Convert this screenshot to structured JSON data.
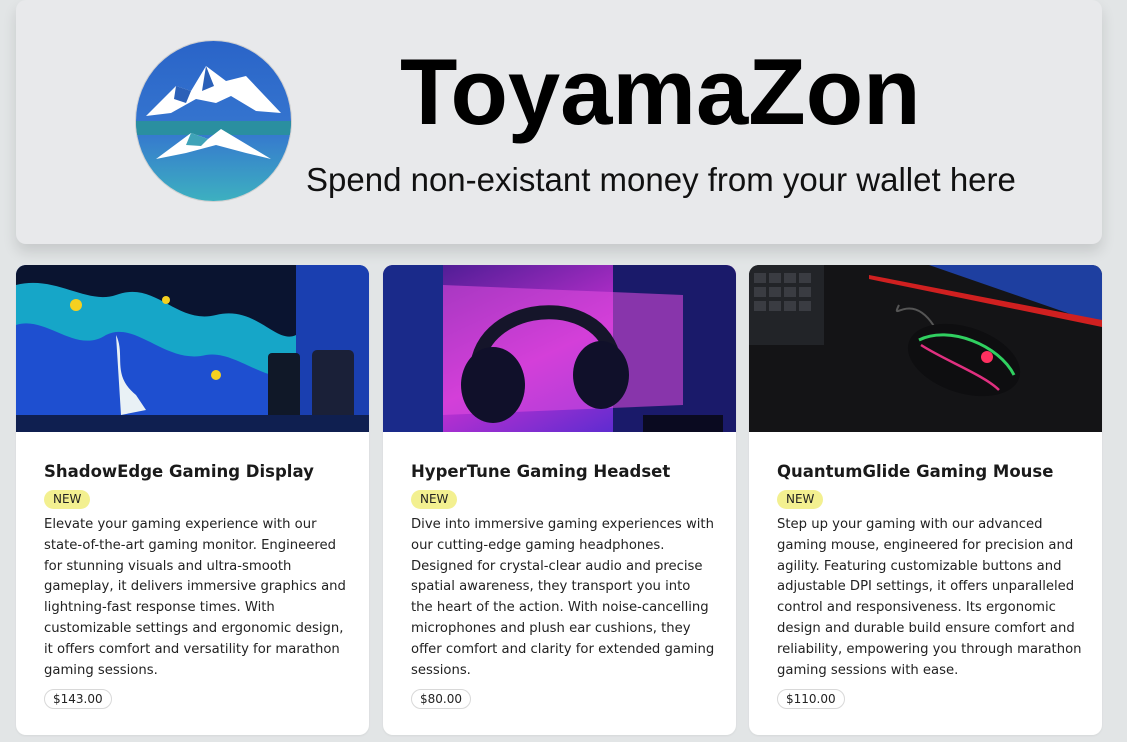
{
  "header": {
    "site_title": "ToyamaZon",
    "tagline": "Spend non-existant money from your wallet here",
    "logo_icon": "mountain-logo-icon"
  },
  "products": [
    {
      "title": "ShadowEdge Gaming Display",
      "badge": "NEW",
      "description": "Elevate your gaming experience with our state-of-the-art gaming monitor. Engineered for stunning visuals and ultra-smooth gameplay, it delivers immersive graphics and lightning-fast response times. With customizable settings and ergonomic design, it offers comfort and versatility for marathon gaming sessions.",
      "price": "$143.00",
      "image_icon": "gaming-monitor-photo"
    },
    {
      "title": "HyperTune Gaming Headset",
      "badge": "NEW",
      "description": "Dive into immersive gaming experiences with our cutting-edge gaming headphones. Designed for crystal-clear audio and precise spatial awareness, they transport you into the heart of the action. With noise-cancelling microphones and plush ear cushions, they offer comfort and clarity for extended gaming sessions.",
      "price": "$80.00",
      "image_icon": "gaming-headset-photo"
    },
    {
      "title": "QuantumGlide Gaming Mouse",
      "badge": "NEW",
      "description": "Step up your gaming with our advanced gaming mouse, engineered for precision and agility. Featuring customizable buttons and adjustable DPI settings, it offers unparalleled control and responsiveness. Its ergonomic design and durable build ensure comfort and reliability, empowering you through marathon gaming sessions with ease.",
      "price": "$110.00",
      "image_icon": "gaming-mouse-photo"
    }
  ],
  "colors": {
    "page_background": "#e2e5e6",
    "header_background": "#e8e9eb",
    "badge_background": "#f3f090",
    "card_background": "#ffffff"
  }
}
